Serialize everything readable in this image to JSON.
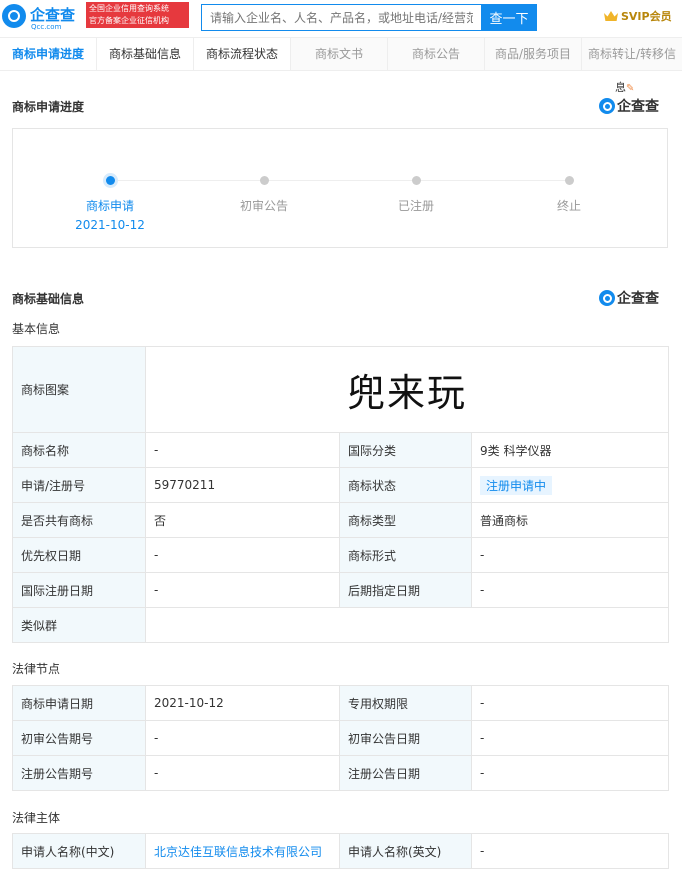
{
  "header": {
    "logo_name": "企查查",
    "logo_domain": "Qcc.com",
    "cert_line1": "全国企业信用查询系统",
    "cert_line2": "官方备案企业征信机构",
    "search_placeholder": "请输入企业名、人名、产品名，或地址电话/经营范",
    "search_button": "查一下",
    "svip": "SVIP会员"
  },
  "tabs": [
    {
      "label": "商标申请进度"
    },
    {
      "label": "商标基础信息"
    },
    {
      "label": "商标流程状态"
    },
    {
      "label": "商标文书"
    },
    {
      "label": "商标公告"
    },
    {
      "label": "商品/服务项目"
    },
    {
      "label": "商标转让/转移信"
    }
  ],
  "feedback": "息",
  "brand": "企查查",
  "progress": {
    "title": "商标申请进度",
    "steps": [
      {
        "label": "商标申请",
        "date": "2021-10-12"
      },
      {
        "label": "初审公告"
      },
      {
        "label": "已注册"
      },
      {
        "label": "终止"
      }
    ]
  },
  "basic": {
    "title": "商标基础信息",
    "subtitle": "基本信息",
    "image_label": "商标图案",
    "image_text": "兜来玩",
    "rows": [
      {
        "k1": "商标名称",
        "v1": "-",
        "k2": "国际分类",
        "v2": "9类 科学仪器"
      },
      {
        "k1": "申请/注册号",
        "v1": "59770211",
        "k2": "商标状态",
        "v2": "注册申请中"
      },
      {
        "k1": "是否共有商标",
        "v1": "否",
        "k2": "商标类型",
        "v2": "普通商标"
      },
      {
        "k1": "优先权日期",
        "v1": "-",
        "k2": "商标形式",
        "v2": "-"
      },
      {
        "k1": "国际注册日期",
        "v1": "-",
        "k2": "后期指定日期",
        "v2": "-"
      }
    ],
    "similar_label": "类似群",
    "similar_value": ""
  },
  "legal": {
    "title": "法律节点",
    "rows": [
      {
        "k1": "商标申请日期",
        "v1": "2021-10-12",
        "k2": "专用权期限",
        "v2": "-"
      },
      {
        "k1": "初审公告期号",
        "v1": "-",
        "k2": "初审公告日期",
        "v2": "-"
      },
      {
        "k1": "注册公告期号",
        "v1": "-",
        "k2": "注册公告日期",
        "v2": "-"
      }
    ]
  },
  "subject": {
    "title": "法律主体",
    "rows": [
      {
        "k1": "申请人名称(中文)",
        "v1": "北京达佳互联信息技术有限公司",
        "k2": "申请人名称(英文)",
        "v2": "-"
      }
    ]
  },
  "colors": {
    "accent": "#128bed",
    "badge": "#e6393e",
    "key_bg": "#f2f9fc"
  }
}
